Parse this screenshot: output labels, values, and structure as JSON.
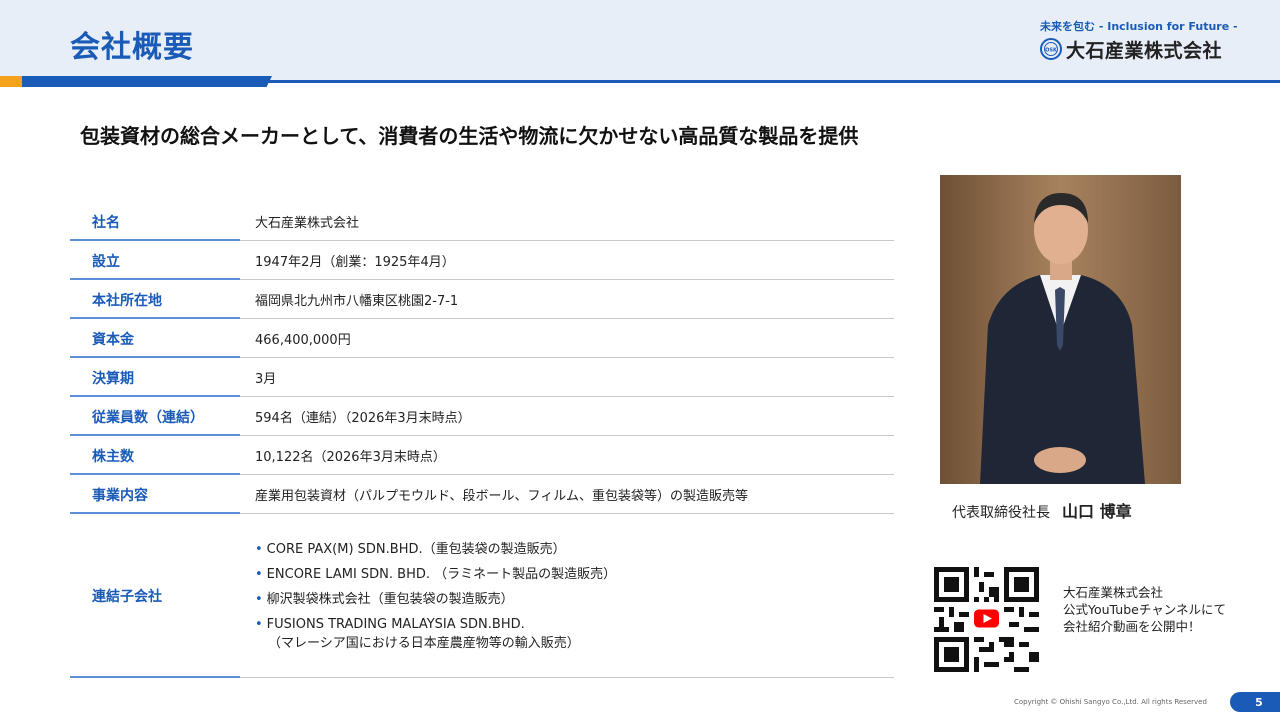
{
  "header": {
    "title": "会社概要",
    "logo_tagline": "未来を包む - Inclusion for Future -",
    "logo_name": "大石産業株式会社",
    "logo_mark_text": "OSK"
  },
  "subtitle": "包装資材の総合メーカーとして、消費者の生活や物流に欠かせない高品質な製品を提供",
  "table": {
    "rows": [
      {
        "label": "社名",
        "value": "大石産業株式会社"
      },
      {
        "label": "設立",
        "value": "1947年2月（創業：1925年4月）"
      },
      {
        "label": "本社所在地",
        "value": "福岡県北九州市八幡東区桃園2-7-1"
      },
      {
        "label": "資本金",
        "value": "466,400,000円"
      },
      {
        "label": "決算期",
        "value": "3月"
      },
      {
        "label": "従業員数（連結）",
        "value": "594名（連結）（2026年3月末時点）"
      },
      {
        "label": "株主数",
        "value": "10,122名（2026年3月末時点）"
      },
      {
        "label": "事業内容",
        "value": "産業用包装資材（パルプモウルド、段ボール、フィルム、重包装袋等）の製造販売等"
      }
    ],
    "subsidiaries": {
      "label": "連結子会社",
      "bullet": "•",
      "items": [
        "CORE PAX(M) SDN.BHD.（重包装袋の製造販売）",
        "ENCORE LAMI SDN. BHD. （ラミネート製品の製造販売）",
        "柳沢製袋株式会社（重包装袋の製造販売）",
        "FUSIONS TRADING MALAYSIA SDN.BHD."
      ],
      "continuation": "（マレーシア国における日本産農産物等の輸入販売）"
    }
  },
  "caption": {
    "title": "代表取締役社長",
    "name": "山口 博章"
  },
  "qr_text": {
    "line1": "大石産業株式会社",
    "line2": "公式YouTubeチャンネルにて",
    "line3": "会社紹介動画を公開中！"
  },
  "footer": {
    "copyright": "Copyright © Ohishi Sangyo Co.,Ltd. All rights Reserved",
    "page": "5"
  },
  "colors": {
    "brand_blue": "#1a5bb8",
    "accent_orange": "#f4a11c",
    "header_bg": "#e7eef8"
  }
}
